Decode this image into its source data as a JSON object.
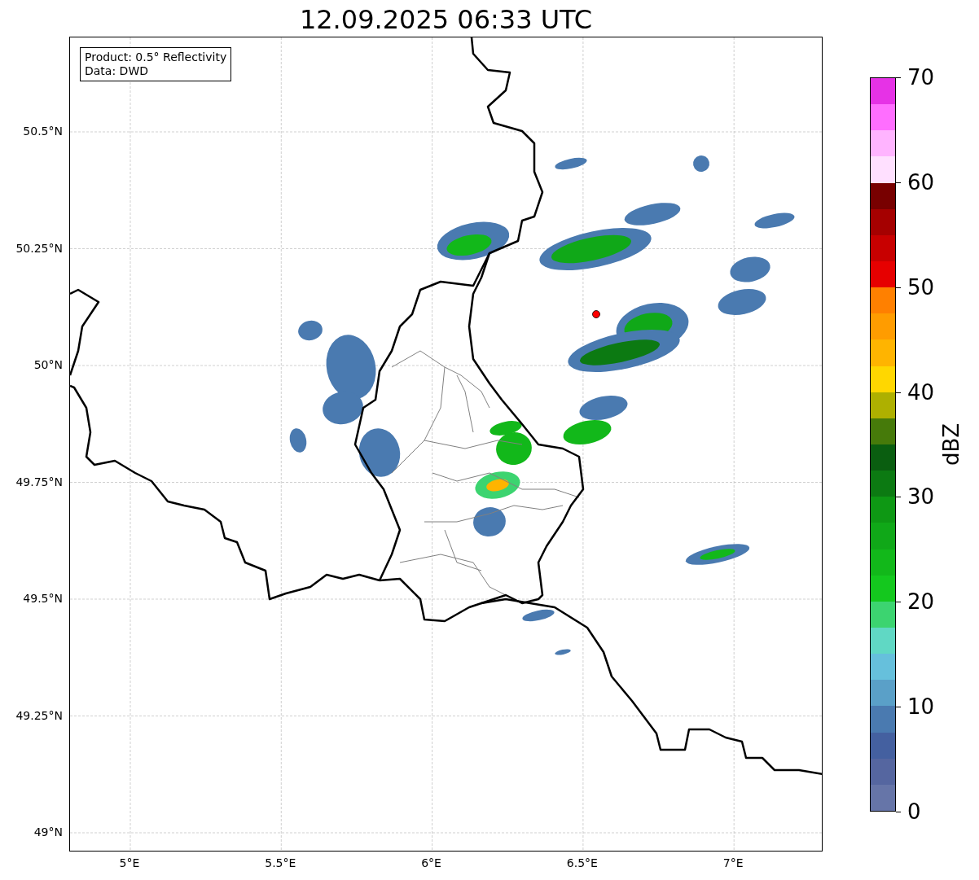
{
  "title": "12.09.2025 06:33 UTC",
  "info_box": {
    "lines": [
      "Product: 0.5° Reflectivity",
      "Data: DWD"
    ]
  },
  "y_axis": {
    "ticks": [
      "50.5°N",
      "50.25°N",
      "50°N",
      "49.75°N",
      "49.5°N",
      "49.25°N",
      "49°N"
    ]
  },
  "x_axis": {
    "ticks": [
      "5°E",
      "5.5°E",
      "6°E",
      "6.5°E",
      "7°E"
    ]
  },
  "colorbar": {
    "label": "dBZ",
    "ticks": [
      "70",
      "60",
      "50",
      "40",
      "30",
      "20",
      "10",
      "0"
    ],
    "bins": [
      {
        "color": "#6675a8"
      },
      {
        "color": "#5566a0"
      },
      {
        "color": "#4460a0"
      },
      {
        "color": "#4a7ab0"
      },
      {
        "color": "#5aa0c8"
      },
      {
        "color": "#66c0dc"
      },
      {
        "color": "#60d8c4"
      },
      {
        "color": "#3cd470"
      },
      {
        "color": "#14c81e"
      },
      {
        "color": "#12b81a"
      },
      {
        "color": "#10a818"
      },
      {
        "color": "#0e9814"
      },
      {
        "color": "#0c7a12"
      },
      {
        "color": "#0a5e10"
      },
      {
        "color": "#467a0a"
      },
      {
        "color": "#aeb000"
      },
      {
        "color": "#ffd700"
      },
      {
        "color": "#ffb400"
      },
      {
        "color": "#ff9c00"
      },
      {
        "color": "#ff8000"
      },
      {
        "color": "#e60000"
      },
      {
        "color": "#c80000"
      },
      {
        "color": "#a50000"
      },
      {
        "color": "#780000"
      },
      {
        "color": "#ffe0ff"
      },
      {
        "color": "#ffb4ff"
      },
      {
        "color": "#ff6eff"
      },
      {
        "color": "#e632e6"
      }
    ]
  }
}
